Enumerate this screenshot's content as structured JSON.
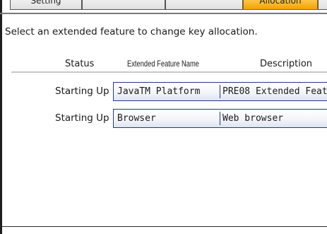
{
  "tabs": {
    "setting": "Setting",
    "allocation": "Allocation"
  },
  "instruction": "Select an extended feature to change key allocation.",
  "table": {
    "headers": {
      "status": "Status",
      "name": "Extended Feature Name",
      "description": "Description"
    },
    "rows": [
      {
        "status": "Starting Up",
        "name": "JavaTM Platform",
        "description": "PRE08 Extended Feat"
      },
      {
        "status": "Starting Up",
        "name": "Browser",
        "description": "Web browser"
      }
    ]
  },
  "colors": {
    "active_tab": "#f3a300",
    "row_border": "#1f3a8a"
  }
}
